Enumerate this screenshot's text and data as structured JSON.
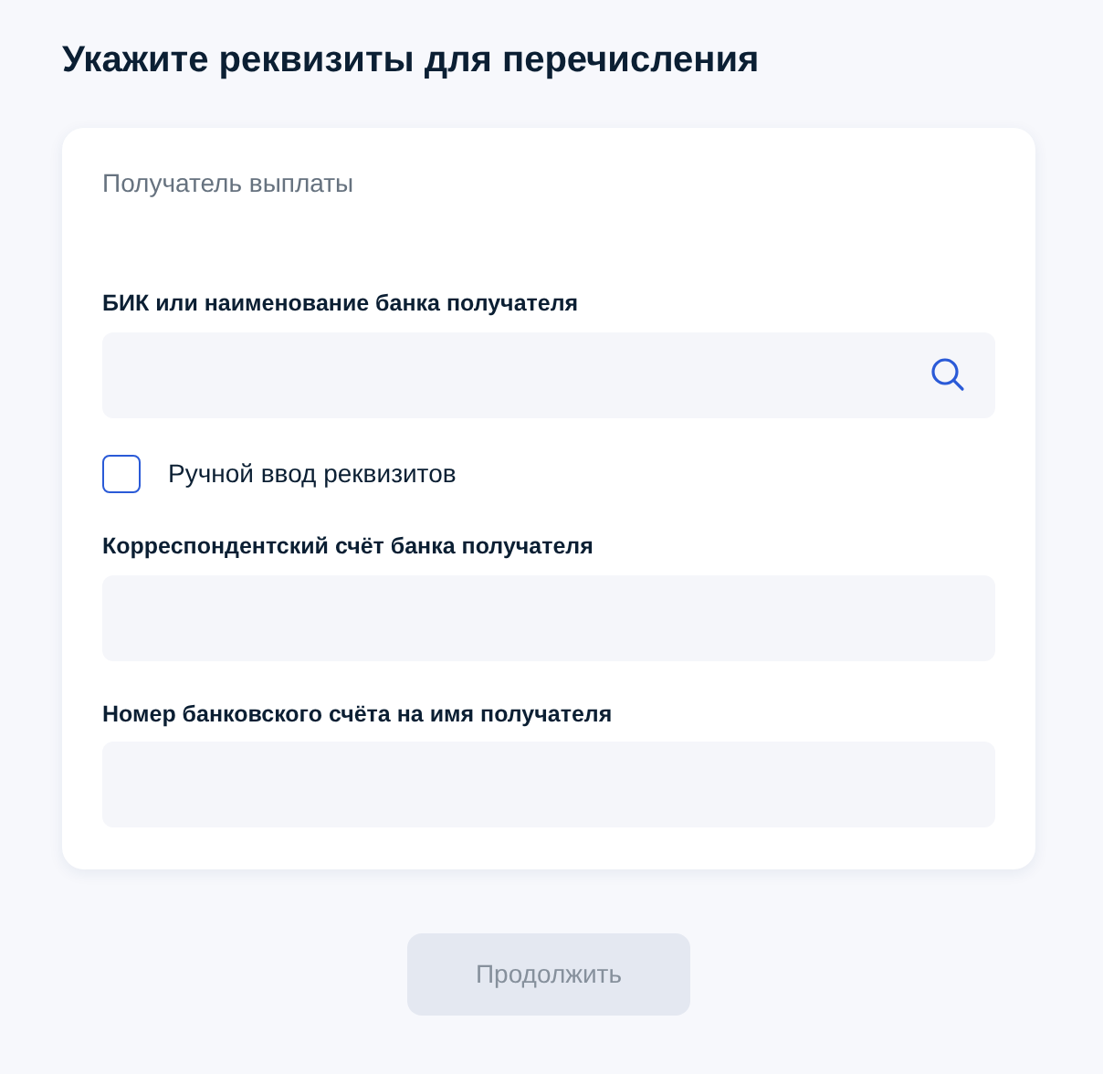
{
  "title": "Укажите реквизиты для перечисления",
  "section": "Получатель выплаты",
  "fields": [
    {
      "label": "БИК или наименование банка получателя",
      "kind": "search"
    },
    {
      "kind": "checkbox",
      "label": "Ручной ввод реквизитов",
      "checked": false
    },
    {
      "label": "Корреспондентский счёт банка получателя",
      "kind": "text"
    },
    {
      "label": "Номер банковского счёта на имя получателя",
      "kind": "text"
    }
  ],
  "button": {
    "label": "Продолжить",
    "disabled": true
  }
}
